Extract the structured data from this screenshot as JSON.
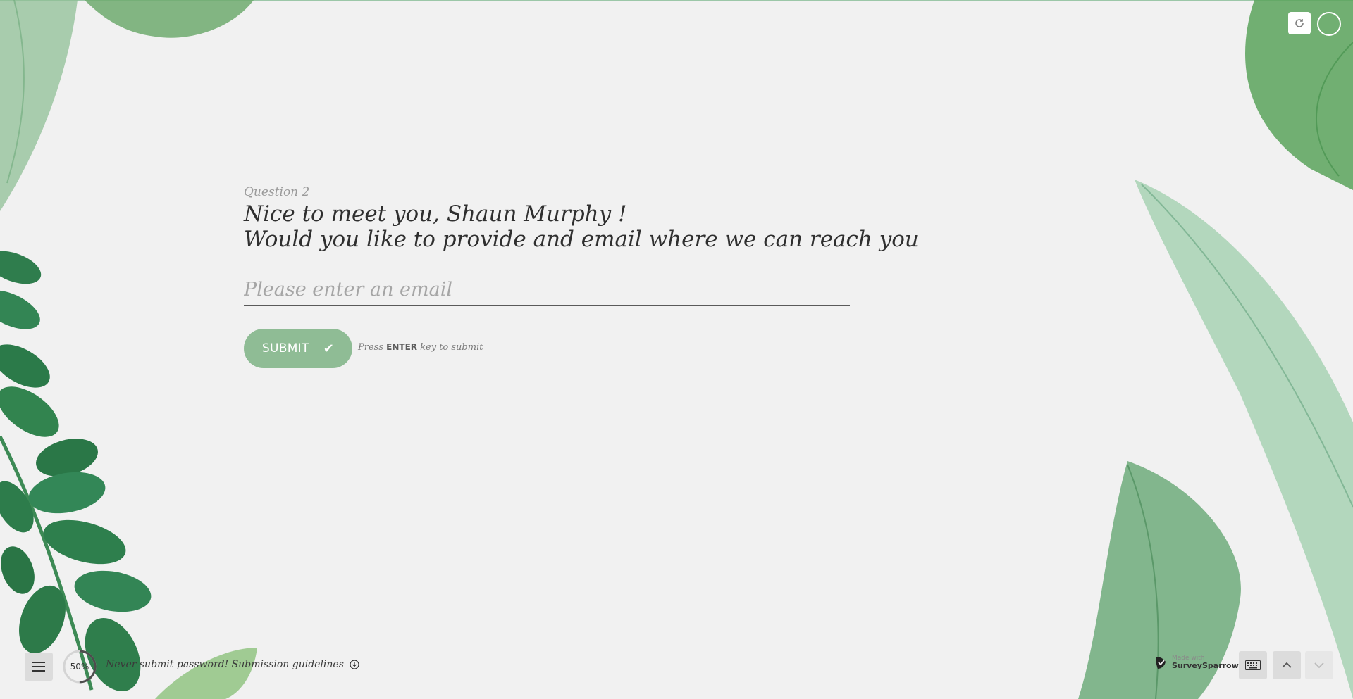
{
  "header": {
    "refresh_icon": "refresh-icon",
    "info_icon": "circle-icon"
  },
  "question": {
    "number": "Question 2",
    "title_line1": "Nice to meet you, Shaun Murphy !",
    "title_line2": "Would you like to provide and email where we can reach you",
    "email_placeholder": "Please enter an email",
    "email_value": ""
  },
  "actions": {
    "submit_label": "SUBMIT",
    "hint_pre": "Press",
    "hint_key": "ENTER",
    "hint_post": "key to submit"
  },
  "footer": {
    "progress": "50%",
    "guidelines": "Never submit password! Submission guidelines",
    "brand_made": "Made with",
    "brand_name": "SurveySparrow"
  },
  "colors": {
    "accent": "#8fbc95",
    "background": "#f1f1f1"
  }
}
